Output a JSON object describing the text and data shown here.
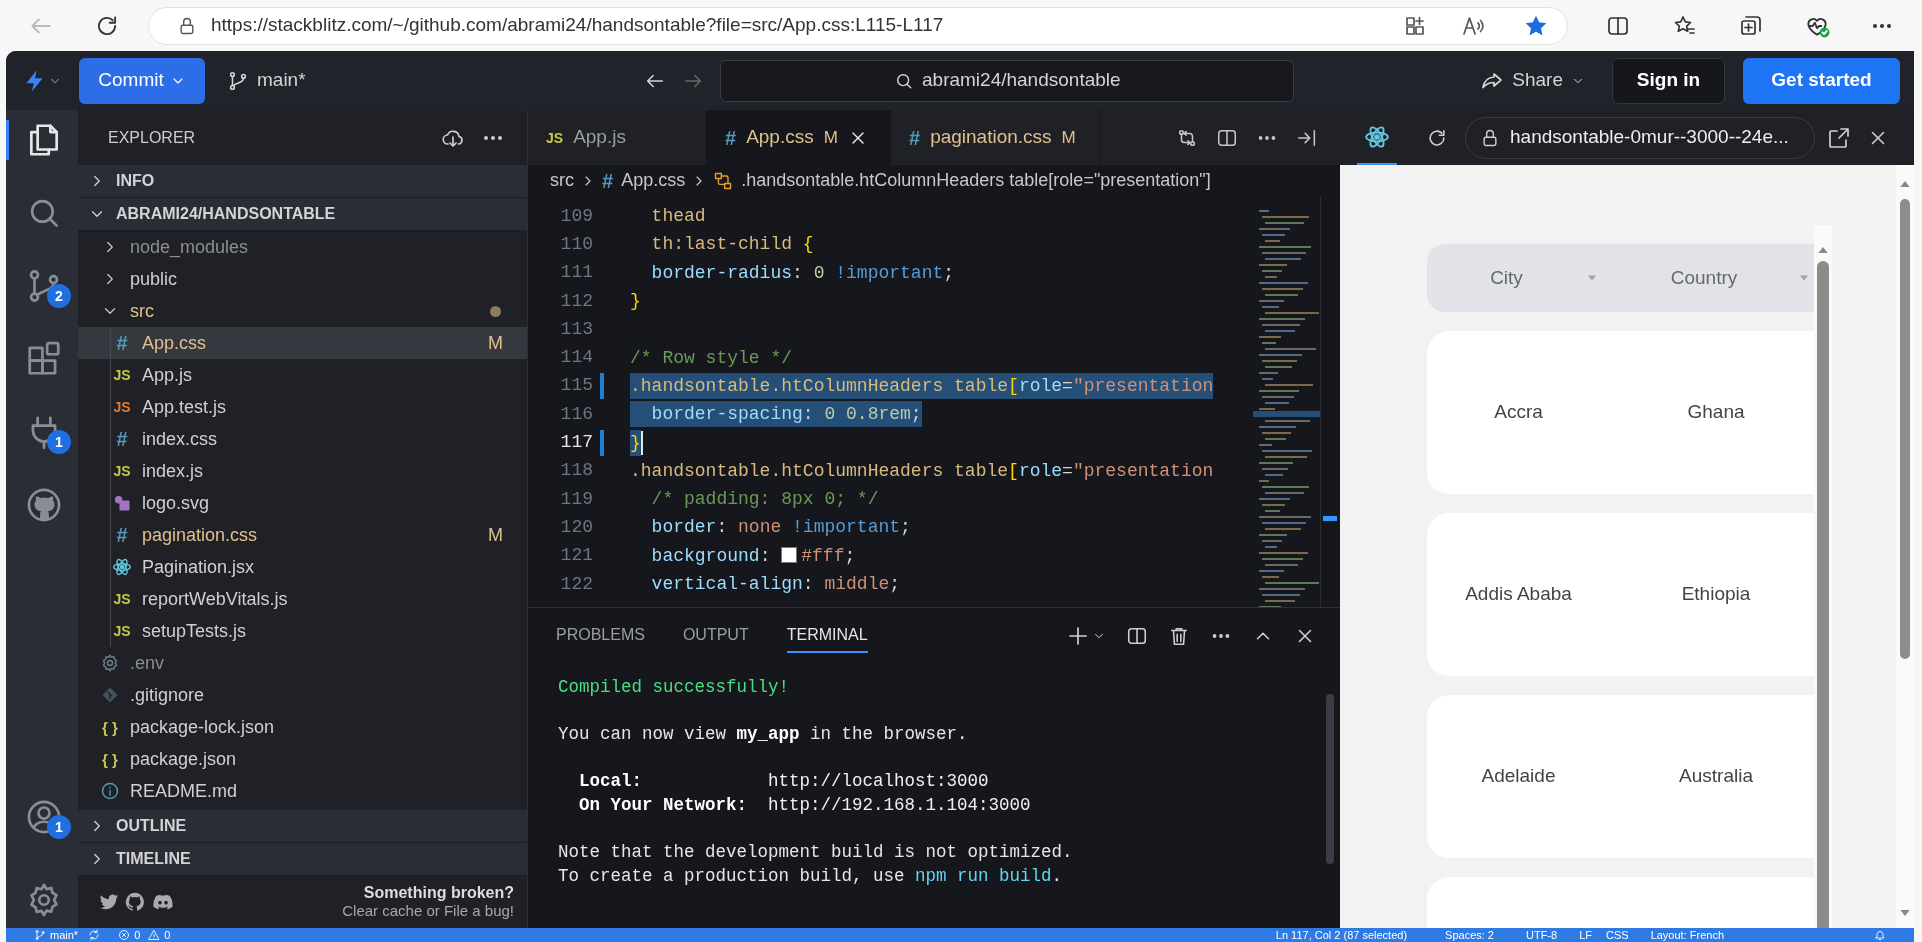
{
  "browser": {
    "url": "https://stackblitz.com/~/github.com/abrami24/handsontable?file=src/App.css:L115-L117"
  },
  "header": {
    "commit_button": "Commit",
    "branch": "main*",
    "search": "abrami24/handsontable",
    "share": "Share",
    "sign_in": "Sign in",
    "get_started": "Get started"
  },
  "activity_bar": [
    {
      "kind": "files",
      "selected": true
    },
    {
      "kind": "search",
      "selected": false
    },
    {
      "kind": "source-control",
      "selected": false,
      "badge": "2"
    },
    {
      "kind": "extensions",
      "selected": false
    },
    {
      "kind": "ports",
      "selected": false,
      "badge": "1"
    },
    {
      "kind": "github",
      "selected": false
    }
  ],
  "activity_bottom": [
    {
      "kind": "account",
      "badge": "1"
    },
    {
      "kind": "settings"
    }
  ],
  "explorer": {
    "title": "EXPLORER",
    "sections": [
      {
        "title": "INFO",
        "expanded": false
      },
      {
        "title": "ABRAMI24/HANDSONTABLE",
        "expanded": true,
        "items": [
          {
            "name": "node_modules",
            "kind": "folder",
            "expanded": false,
            "modified": false,
            "ignored": true,
            "selected": false
          },
          {
            "name": "public",
            "kind": "folder",
            "expanded": false,
            "modified": false,
            "ignored": false,
            "selected": false
          },
          {
            "name": "src",
            "kind": "folder",
            "expanded": true,
            "modified": true,
            "ignored": false,
            "selected": false,
            "children": [
              {
                "name": "App.css",
                "kind": "css",
                "icon_text": "#",
                "modified": true,
                "ignored": false,
                "badge": "M",
                "selected": true
              },
              {
                "name": "App.js",
                "kind": "js",
                "icon_text": "JS",
                "modified": false,
                "ignored": false,
                "selected": false
              },
              {
                "name": "App.test.js",
                "kind": "jstest",
                "icon_text": "JS",
                "modified": false,
                "ignored": false,
                "selected": false
              },
              {
                "name": "index.css",
                "kind": "css",
                "icon_text": "#",
                "modified": false,
                "ignored": false,
                "selected": false
              },
              {
                "name": "index.js",
                "kind": "js",
                "icon_text": "JS",
                "modified": false,
                "ignored": false,
                "selected": false
              },
              {
                "name": "logo.svg",
                "kind": "image",
                "modified": false,
                "ignored": false,
                "selected": false
              },
              {
                "name": "pagination.css",
                "kind": "css",
                "icon_text": "#",
                "modified": true,
                "ignored": false,
                "badge": "M",
                "selected": false
              },
              {
                "name": "Pagination.jsx",
                "kind": "react",
                "modified": false,
                "ignored": false,
                "selected": false
              },
              {
                "name": "reportWebVitals.js",
                "kind": "js",
                "icon_text": "JS",
                "modified": false,
                "ignored": false,
                "selected": false
              },
              {
                "name": "setupTests.js",
                "kind": "js",
                "icon_text": "JS",
                "modified": false,
                "ignored": false,
                "selected": false
              }
            ]
          },
          {
            "name": ".env",
            "kind": "config",
            "modified": false,
            "ignored": true,
            "selected": false
          },
          {
            "name": ".gitignore",
            "kind": "git",
            "modified": false,
            "ignored": false,
            "selected": false
          },
          {
            "name": "package-lock.json",
            "kind": "json",
            "icon_text": "{ }",
            "modified": false,
            "ignored": false,
            "selected": false
          },
          {
            "name": "package.json",
            "kind": "json",
            "icon_text": "{ }",
            "modified": false,
            "ignored": false,
            "selected": false
          },
          {
            "name": "README.md",
            "kind": "info",
            "modified": false,
            "ignored": false,
            "selected": false
          }
        ]
      },
      {
        "title": "OUTLINE",
        "expanded": false
      },
      {
        "title": "TIMELINE",
        "expanded": false
      }
    ],
    "footer": {
      "heading": "Something broken?",
      "subtext": "Clear cache or File a bug!"
    }
  },
  "editor": {
    "tabs": [
      {
        "name": "App.js",
        "kind": "js",
        "icon_text": "JS",
        "selected": false
      },
      {
        "name": "App.css",
        "kind": "css",
        "icon_text": "#",
        "badge": "M",
        "selected": true
      },
      {
        "name": "pagination.css",
        "kind": "css",
        "icon_text": "#",
        "badge": "M",
        "selected": false
      }
    ],
    "breadcrumb": [
      {
        "text": "src",
        "kind": "folder"
      },
      {
        "text": "App.css",
        "kind": "css",
        "icon_text": "#"
      },
      {
        "text": ".handsontable.htColumnHeaders table[role=\"presentation\"]",
        "kind": "symbol"
      }
    ],
    "lines": [
      {
        "number": "109",
        "selected": false,
        "modified": false,
        "current": false,
        "tokens": [
          {
            "text": "  thead",
            "kind": "selector"
          }
        ]
      },
      {
        "number": "110",
        "selected": false,
        "modified": false,
        "current": false,
        "tokens": [
          {
            "text": "  th:last-child ",
            "kind": "selector"
          },
          {
            "text": "{",
            "kind": "brace"
          }
        ]
      },
      {
        "number": "111",
        "selected": false,
        "modified": false,
        "current": false,
        "tokens": [
          {
            "text": "  border-radius",
            "kind": "property"
          },
          {
            "text": ": ",
            "kind": "punct"
          },
          {
            "text": "0",
            "kind": "number"
          },
          {
            "text": " !important",
            "kind": "keyword"
          },
          {
            "text": ";",
            "kind": "punct"
          }
        ]
      },
      {
        "number": "112",
        "selected": false,
        "modified": false,
        "current": false,
        "tokens": [
          {
            "text": "}",
            "kind": "brace"
          }
        ]
      },
      {
        "number": "113",
        "selected": false,
        "modified": false,
        "current": false
      },
      {
        "number": "114",
        "selected": false,
        "modified": false,
        "current": false,
        "tokens": [
          {
            "text": "/* Row style */",
            "kind": "comment"
          }
        ]
      },
      {
        "number": "115",
        "selected": true,
        "modified": true,
        "current": false,
        "tokens": [
          {
            "text": ".handsontable.htColumnHeaders table",
            "kind": "selector"
          },
          {
            "text": "[",
            "kind": "brace"
          },
          {
            "text": "role",
            "kind": "attr"
          },
          {
            "text": "=",
            "kind": "punct"
          },
          {
            "text": "\"presentation",
            "kind": "string"
          }
        ]
      },
      {
        "number": "116",
        "selected": true,
        "modified": false,
        "current": false,
        "tokens": [
          {
            "text": "  border-spacing",
            "kind": "property"
          },
          {
            "text": ": ",
            "kind": "punct"
          },
          {
            "text": "0 0.8rem",
            "kind": "number"
          },
          {
            "text": ";",
            "kind": "punct"
          }
        ]
      },
      {
        "number": "117",
        "selected": true,
        "modified": true,
        "current": true,
        "tokens": [
          {
            "text": "}",
            "kind": "brace"
          }
        ]
      },
      {
        "number": "118",
        "selected": false,
        "modified": false,
        "current": false,
        "tokens": [
          {
            "text": ".handsontable.htColumnHeaders table",
            "kind": "selector"
          },
          {
            "text": "[",
            "kind": "brace"
          },
          {
            "text": "role",
            "kind": "attr"
          },
          {
            "text": "=",
            "kind": "punct"
          },
          {
            "text": "\"presentation",
            "kind": "string"
          }
        ]
      },
      {
        "number": "119",
        "selected": false,
        "modified": false,
        "current": false,
        "tokens": [
          {
            "text": "  /* padding: 8px 0; */",
            "kind": "comment"
          }
        ]
      },
      {
        "number": "120",
        "selected": false,
        "modified": false,
        "current": false,
        "tokens": [
          {
            "text": "  border",
            "kind": "property"
          },
          {
            "text": ": ",
            "kind": "punct"
          },
          {
            "text": "none",
            "kind": "value"
          },
          {
            "text": " !important",
            "kind": "keyword"
          },
          {
            "text": ";",
            "kind": "punct"
          }
        ]
      },
      {
        "number": "121",
        "selected": false,
        "modified": false,
        "current": false,
        "tokens": [
          {
            "text": "  background",
            "kind": "property"
          },
          {
            "text": ": ",
            "kind": "punct"
          },
          {
            "text": "#fff",
            "kind": "color"
          },
          {
            "text": ";",
            "kind": "punct"
          }
        ]
      },
      {
        "number": "122",
        "selected": false,
        "modified": false,
        "current": false,
        "tokens": [
          {
            "text": "  vertical-align",
            "kind": "property"
          },
          {
            "text": ": ",
            "kind": "punct"
          },
          {
            "text": "middle",
            "kind": "value"
          },
          {
            "text": ";",
            "kind": "punct"
          }
        ]
      }
    ]
  },
  "panel": {
    "tabs": [
      {
        "label": "PROBLEMS",
        "selected": false
      },
      {
        "label": "OUTPUT",
        "selected": false
      },
      {
        "label": "TERMINAL",
        "selected": true
      }
    ],
    "blocks": [
      {
        "lines": [
          {
            "segments": [
              {
                "text": "Compiled successfully!",
                "kind": "success"
              }
            ]
          }
        ]
      },
      {
        "lines": [
          {
            "segments": [
              {
                "text": "You can now view ",
                "kind": "plain"
              },
              {
                "text": "my_app",
                "kind": "bold"
              },
              {
                "text": " in the browser.",
                "kind": "plain"
              }
            ]
          }
        ]
      },
      {
        "lines": [
          {
            "segments": [
              {
                "text": "  Local:",
                "kind": "bold"
              },
              {
                "text": "            http://localhost:3000",
                "kind": "url"
              }
            ]
          },
          {
            "segments": [
              {
                "text": "  On Your Network:",
                "kind": "bold"
              },
              {
                "text": "  http://192.168.1.104:3000",
                "kind": "url"
              }
            ]
          }
        ]
      },
      {
        "lines": [
          {
            "segments": [
              {
                "text": "Note that the development build is not optimized.",
                "kind": "plain"
              }
            ]
          },
          {
            "segments": [
              {
                "text": "To create a production build, use ",
                "kind": "plain"
              },
              {
                "text": "npm run build",
                "kind": "command"
              },
              {
                "text": ".",
                "kind": "plain"
              }
            ]
          }
        ]
      }
    ]
  },
  "preview": {
    "url": "handsontable-0mur--3000--24e...",
    "columns": [
      "City",
      "Country"
    ],
    "rows": [
      [
        "Accra",
        "Ghana"
      ],
      [
        "Addis Ababa",
        "Ethiopia"
      ],
      [
        "Adelaide",
        "Australia"
      ]
    ]
  },
  "status_bar": {
    "branch": "main*",
    "errors": "0",
    "warnings": "0",
    "position": "Ln 117, Col 2 (87 selected)",
    "indent": "Spaces: 2",
    "encoding": "UTF-8",
    "eol": "LF",
    "language": "CSS",
    "layout": "Layout: French"
  }
}
